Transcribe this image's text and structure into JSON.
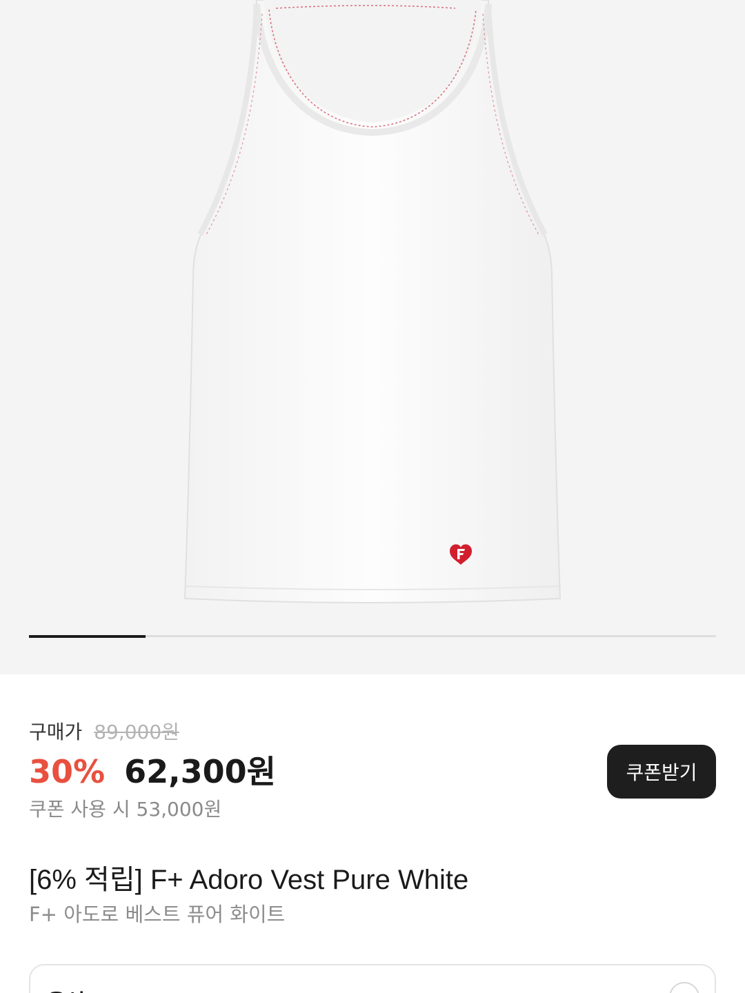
{
  "product_image": {
    "alt": "White ribbed tank top with red heart F logo",
    "carousel_progress": 0.17
  },
  "pricing": {
    "buy_label": "구매가",
    "original_price": "89,000원",
    "discount_rate": "30%",
    "sale_price": "62,300원",
    "coupon_price_text": "쿠폰 사용 시 53,000원",
    "coupon_button_label": "쿠폰받기"
  },
  "product": {
    "title": "[6% 적립] F+ Adoro Vest Pure White",
    "subtitle": "F+ 아도로 베스트 퓨어 화이트"
  },
  "option": {
    "label": "옵션",
    "icon": "chevron-down-icon"
  },
  "colors": {
    "accent_discount": "#e8503f",
    "button_bg": "#1e1e1e",
    "logo_red": "#d21f2e"
  }
}
